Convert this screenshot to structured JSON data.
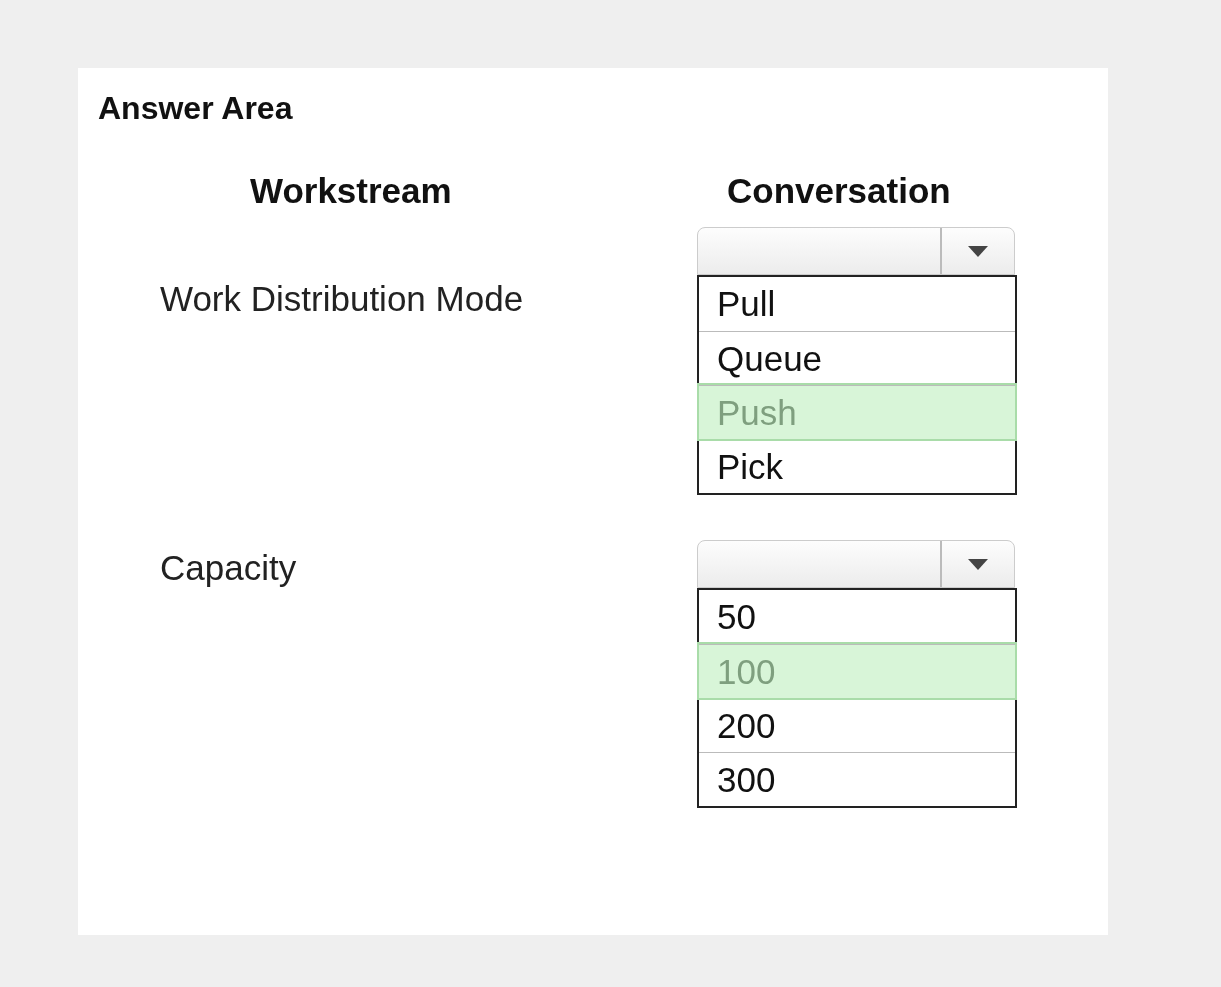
{
  "title": "Answer Area",
  "columns": [
    "Workstream",
    "Conversation"
  ],
  "rows": [
    {
      "label": "Work Distribution Mode",
      "options": [
        {
          "label": "Pull",
          "selected": false
        },
        {
          "label": "Queue",
          "selected": false
        },
        {
          "label": "Push",
          "selected": true
        },
        {
          "label": "Pick",
          "selected": false
        }
      ]
    },
    {
      "label": "Capacity",
      "options": [
        {
          "label": "50",
          "selected": false
        },
        {
          "label": "100",
          "selected": true
        },
        {
          "label": "200",
          "selected": false
        },
        {
          "label": "300",
          "selected": false
        }
      ]
    }
  ]
}
